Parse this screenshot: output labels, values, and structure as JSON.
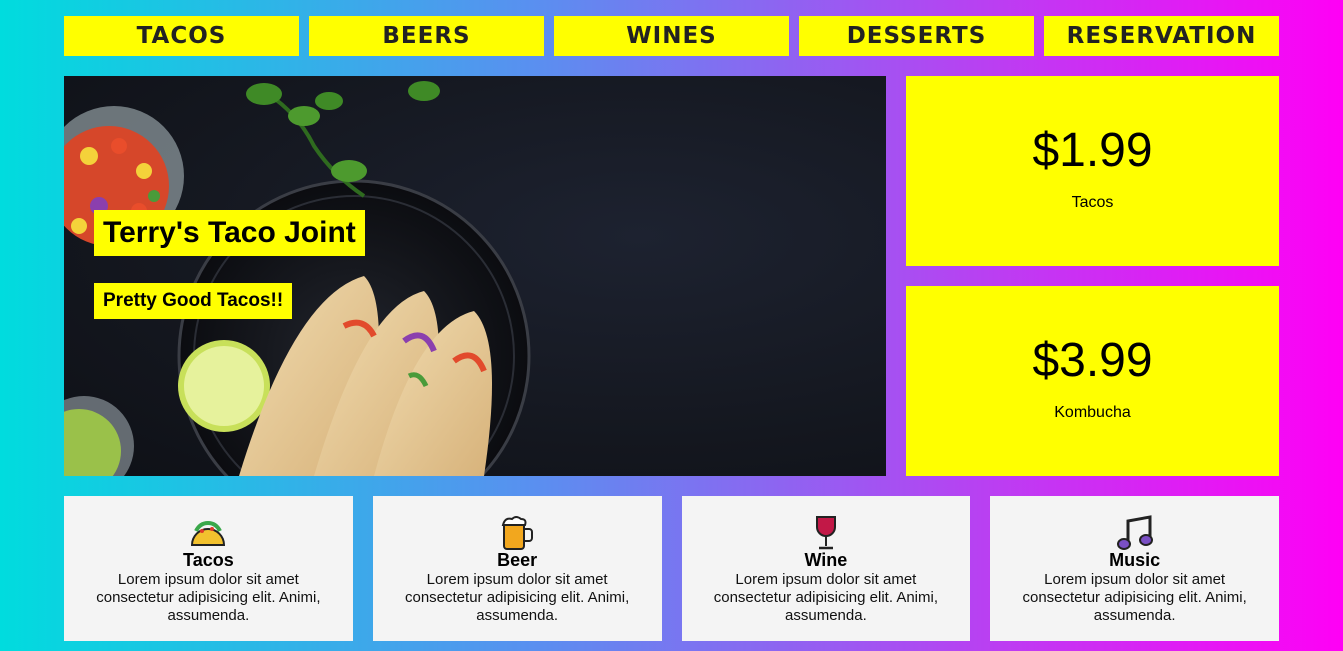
{
  "nav": {
    "items": [
      "TACOS",
      "BEERS",
      "WINES",
      "DESSERTS",
      "RESERVATION"
    ]
  },
  "hero": {
    "title": "Terry's Taco Joint",
    "subtitle": "Pretty Good Tacos!!"
  },
  "prices": [
    {
      "amount": "$1.99",
      "label": "Tacos"
    },
    {
      "amount": "$3.99",
      "label": "Kombucha"
    }
  ],
  "features": [
    {
      "icon": "taco-icon",
      "title": "Tacos",
      "text": "Lorem ipsum dolor sit amet consectetur adipisicing elit. Animi, assumenda."
    },
    {
      "icon": "beer-mug-icon",
      "title": "Beer",
      "text": "Lorem ipsum dolor sit amet consectetur adipisicing elit. Animi, assumenda."
    },
    {
      "icon": "wine-glass-icon",
      "title": "Wine",
      "text": "Lorem ipsum dolor sit amet consectetur adipisicing elit. Animi, assumenda."
    },
    {
      "icon": "music-note-icon",
      "title": "Music",
      "text": "Lorem ipsum dolor sit amet consectetur adipisicing elit. Animi, assumenda."
    }
  ],
  "colors": {
    "accent": "#ffff00",
    "card": "#f4f4f4",
    "gradient_start": "#00dcde",
    "gradient_end": "#ff00f5"
  }
}
